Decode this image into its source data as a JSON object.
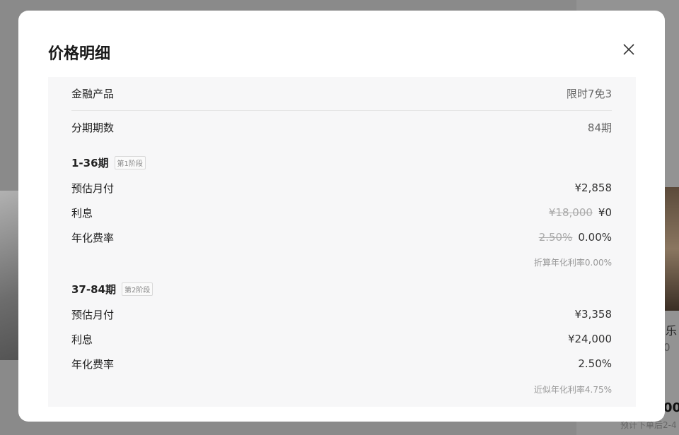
{
  "background": {
    "partial_title": "乐",
    "partial_sub": "0",
    "partial_price": "00",
    "partial_note": "预计下单后2-4"
  },
  "modal": {
    "title": "价格明细",
    "finance_product": {
      "label": "金融产品",
      "value": "限时7免3"
    },
    "installments": {
      "label": "分期期数",
      "value": "84期"
    },
    "stage1": {
      "title": "1-36期",
      "tag": "第1阶段",
      "monthly": {
        "label": "预估月付",
        "value": "¥2,858"
      },
      "interest": {
        "label": "利息",
        "original": "¥18,000",
        "value": "¥0"
      },
      "rate": {
        "label": "年化费率",
        "original": "2.50%",
        "value": "0.00%"
      },
      "note": "折算年化利率0.00%"
    },
    "stage2": {
      "title": "37-84期",
      "tag": "第2阶段",
      "monthly": {
        "label": "预估月付",
        "value": "¥3,358"
      },
      "interest": {
        "label": "利息",
        "value": "¥24,000"
      },
      "rate": {
        "label": "年化费率",
        "value": "2.50%"
      },
      "note": "近似年化利率4.75%"
    }
  },
  "icons": {
    "close": "close-icon"
  }
}
